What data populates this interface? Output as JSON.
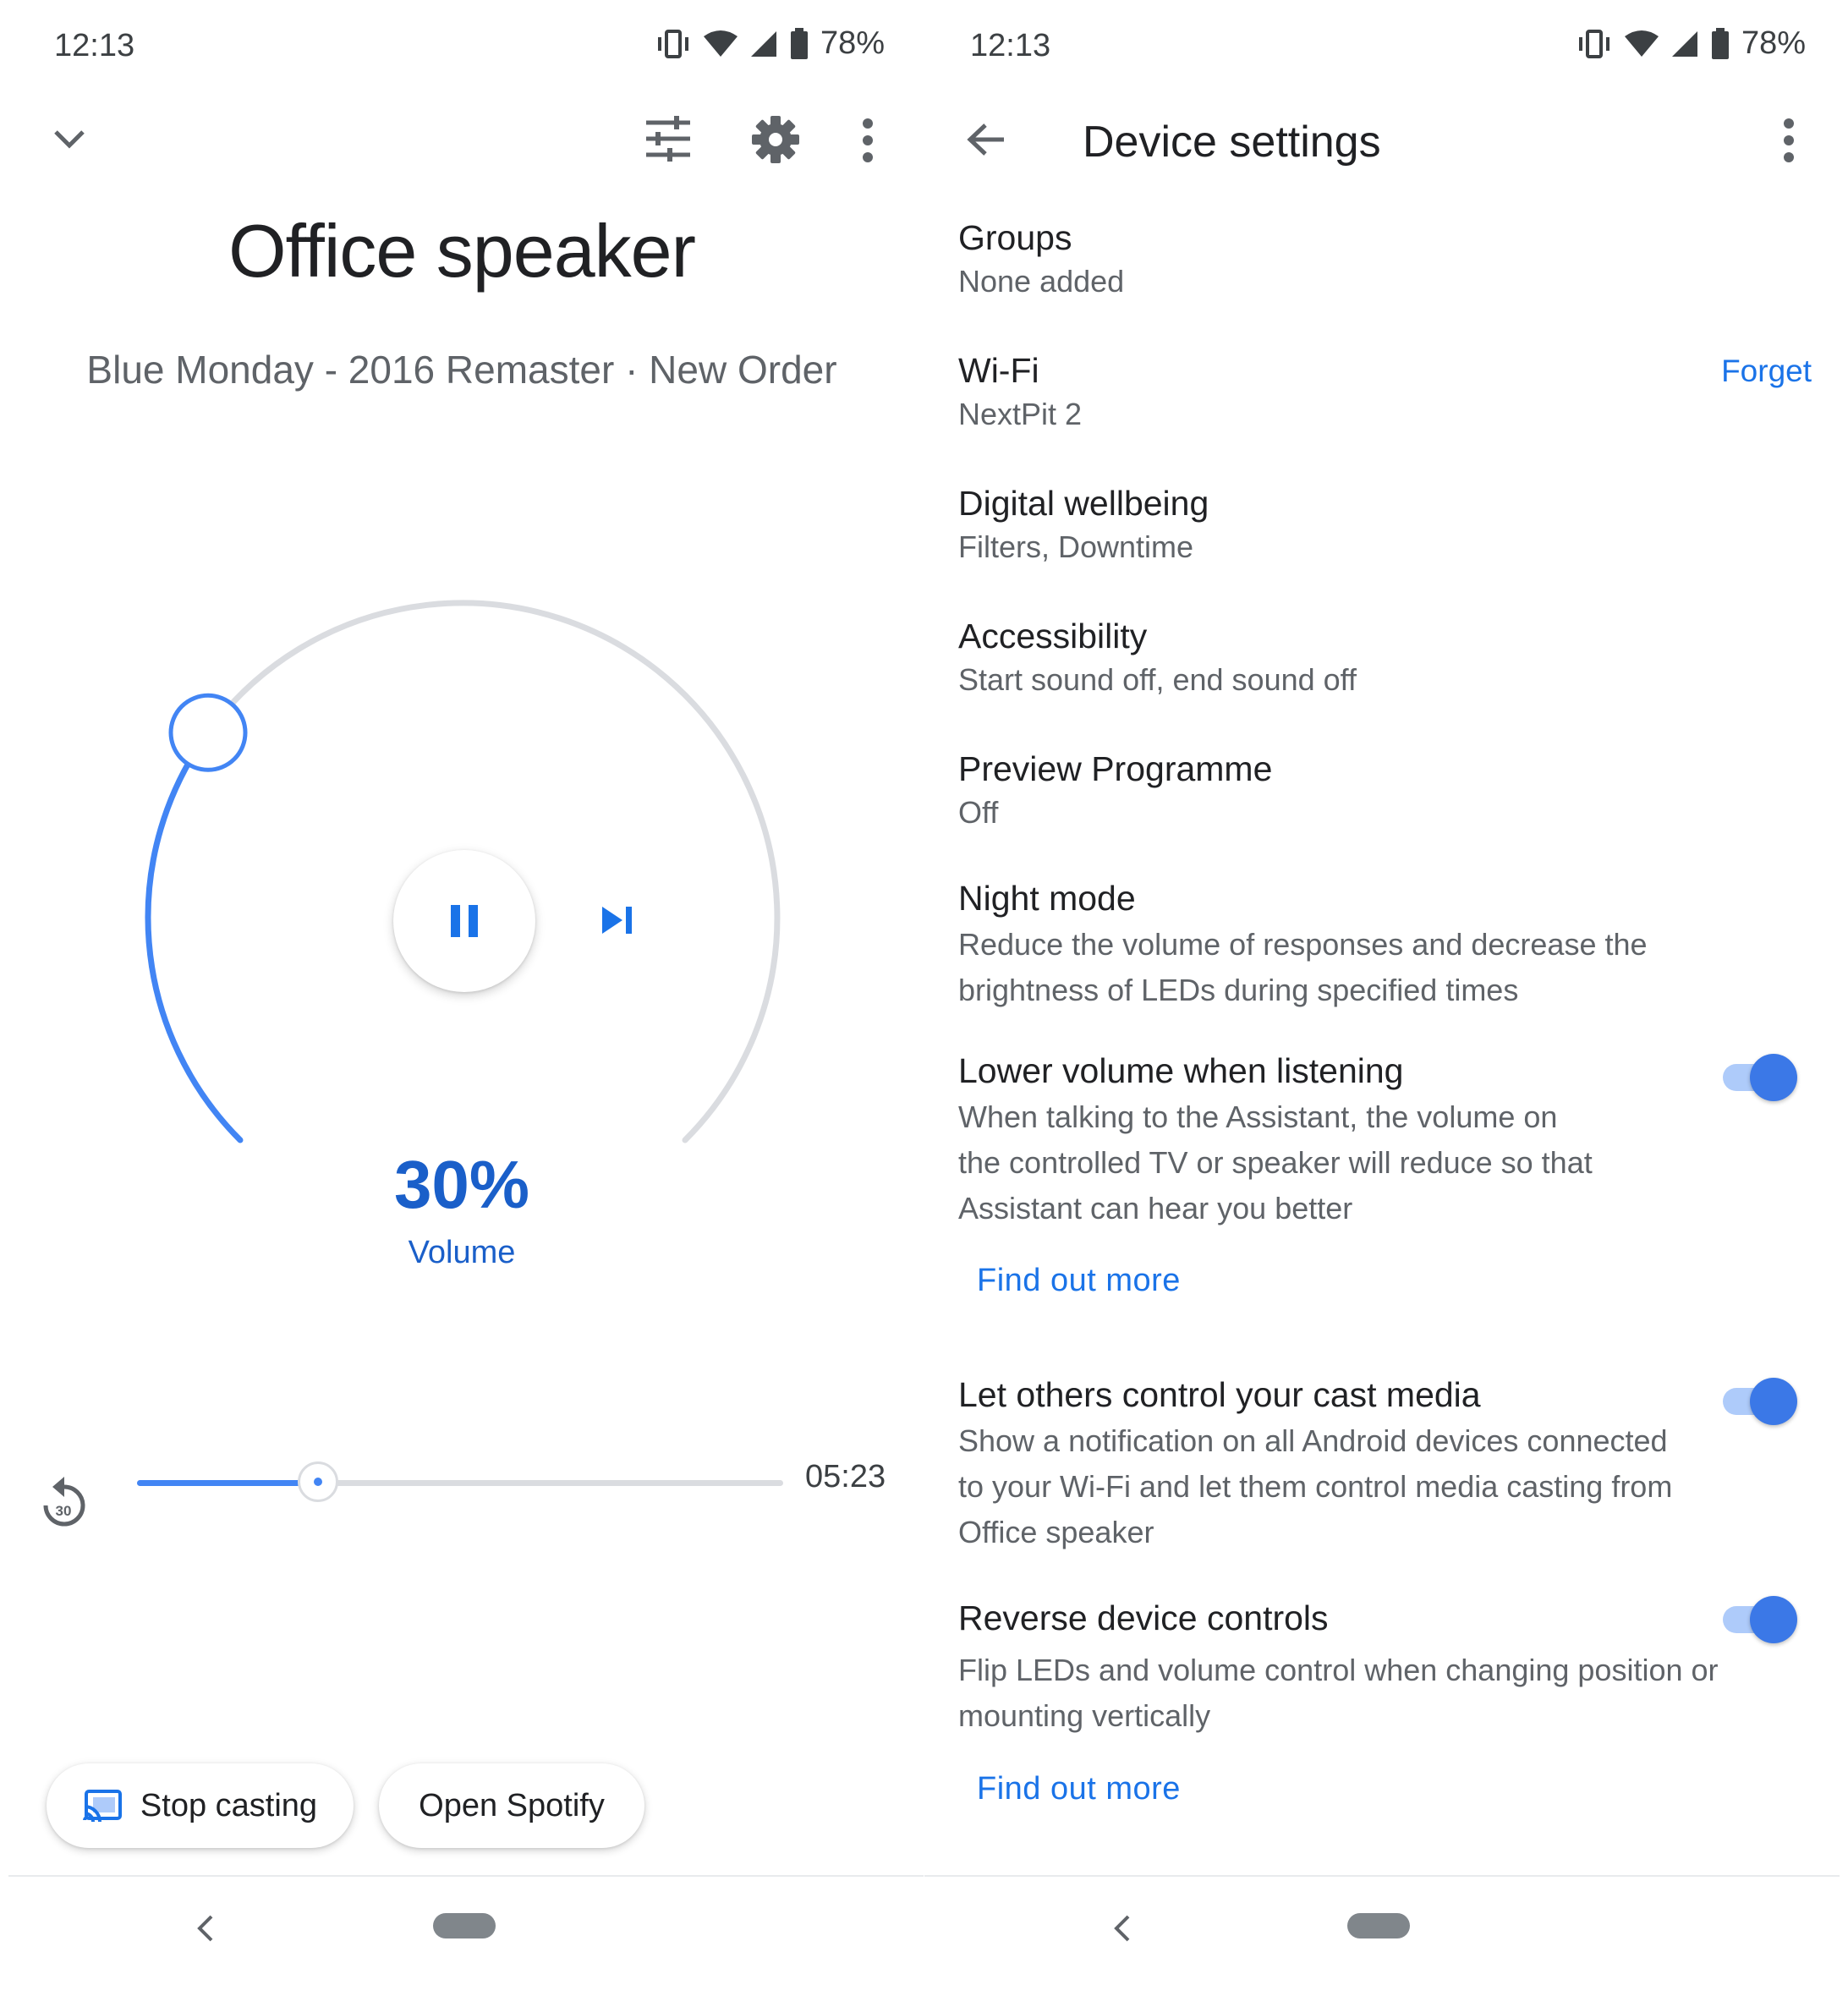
{
  "left": {
    "status": {
      "time": "12:13",
      "battery": "78%"
    },
    "device_title": "Office speaker",
    "track_info": "Blue Monday - 2016 Remaster · New Order",
    "volume": {
      "percent_label": "30%",
      "label": "Volume",
      "level": 0.3
    },
    "playback": {
      "duration": "05:23",
      "progress": 0.28,
      "replay_seconds": "30"
    },
    "buttons": {
      "stop_casting": "Stop casting",
      "open_spotify": "Open Spotify"
    },
    "colors": {
      "accent": "#4285f4",
      "text_blue": "#1a5fc9",
      "track_gray": "#dadce0"
    }
  },
  "right": {
    "status": {
      "time": "12:13",
      "battery": "78%"
    },
    "header": {
      "title": "Device settings"
    },
    "settings": [
      {
        "title": "Groups",
        "subtitle": "None added"
      },
      {
        "title": "Wi-Fi",
        "subtitle": "NextPit 2",
        "action": "Forget"
      },
      {
        "title": "Digital wellbeing",
        "subtitle": "Filters, Downtime"
      },
      {
        "title": "Accessibility",
        "subtitle": "Start sound off, end sound off"
      },
      {
        "title": "Preview Programme",
        "subtitle": "Off"
      },
      {
        "title": "Night mode",
        "subtitle_lines": [
          "Reduce the volume of responses and decrease the",
          "brightness of LEDs during specified times"
        ]
      },
      {
        "title": "Lower volume when listening",
        "subtitle_lines": [
          "When talking to the Assistant, the volume on",
          "the controlled TV or speaker will reduce so that",
          "Assistant can hear you better"
        ],
        "link": "Find out more",
        "enabled": true
      },
      {
        "title": "Let others control your cast media",
        "subtitle_lines": [
          "Show a notification on all Android devices connected",
          "to your Wi-Fi and let them control media casting from",
          "Office speaker"
        ],
        "enabled": true
      },
      {
        "title": "Reverse device controls",
        "subtitle_lines": [
          "Flip LEDs and volume control when changing position or",
          "mounting vertically"
        ],
        "link": "Find out more",
        "enabled": true
      }
    ],
    "colors": {
      "link": "#1a73e8",
      "toggle_thumb": "#3b78e7",
      "toggle_track": "#aecbfa"
    }
  }
}
